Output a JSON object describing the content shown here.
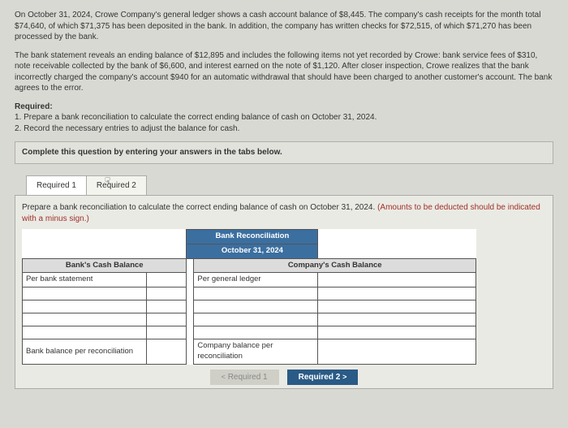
{
  "problem": {
    "p1": "On October 31, 2024, Crowe Company's general ledger shows a cash account balance of $8,445. The company's cash receipts for the month total $74,640, of which $71,375 has been deposited in the bank. In addition, the company has written checks for $72,515, of which $71,270 has been processed by the bank.",
    "p2": "The bank statement reveals an ending balance of $12,895 and includes the following items not yet recorded by Crowe: bank service fees of $310, note receivable collected by the bank of $6,600, and interest earned on the note of $1,120. After closer inspection, Crowe realizes that the bank incorrectly charged the company's account $940 for an automatic withdrawal that should have been charged to another customer's account. The bank agrees to the error.",
    "req_head": "Required:",
    "req1": "1. Prepare a bank reconciliation to calculate the correct ending balance of cash on October 31, 2024.",
    "req2": "2. Record the necessary entries to adjust the balance for cash."
  },
  "instruct": "Complete this question by entering your answers in the tabs below.",
  "tabs": {
    "t1": "Required 1",
    "t2": "Required 2"
  },
  "panel": {
    "prompt_main": "Prepare a bank reconciliation to calculate the correct ending balance of cash on October 31, 2024. ",
    "prompt_hint": "(Amounts to be deducted should be indicated with a minus sign.)"
  },
  "table": {
    "title": "Bank Reconciliation",
    "date": "October 31, 2024",
    "left_head": "Bank's Cash Balance",
    "right_head": "Company's Cash Balance",
    "left_row1": "Per bank statement",
    "right_row1": "Per general ledger",
    "left_total": "Bank balance per reconciliation",
    "right_total": "Company balance per reconciliation"
  },
  "nav": {
    "prev": "Required 1",
    "next": "Required 2"
  }
}
